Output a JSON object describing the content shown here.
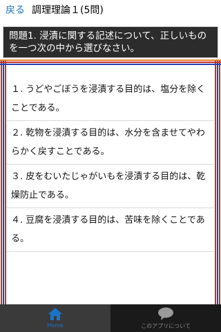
{
  "header": {
    "back_label": "戻る",
    "title": "調理理論１(5問)"
  },
  "question": {
    "text": "問題1. 浸漬に関する記述について、正しいものを一つ次の中から選びなさい。"
  },
  "choices": [
    "１. うどやごぼうを浸漬する目的は、塩分を除くことである。",
    "２. 乾物を浸漬する目的は、水分を含ませてやわらかく戻すことである。",
    "３. 皮をむいたじゃがいもを浸漬する目的は、乾燥防止である。",
    "４. 豆腐を浸漬する目的は、苦味を除くことである。"
  ],
  "tabs": {
    "home_label": "Home",
    "about_label": "このアプリについて"
  },
  "colors": {
    "accent": "#1a73c9",
    "question_bg": "#2c2c2c",
    "tabbar_bg": "#1a1a1a",
    "stripe_orange": "#e8822a",
    "stripe_red": "#c0302a",
    "stripe_blue": "#2a3fb0"
  },
  "icons": {
    "home": "home-icon",
    "about": "speech-bubble-icon"
  }
}
